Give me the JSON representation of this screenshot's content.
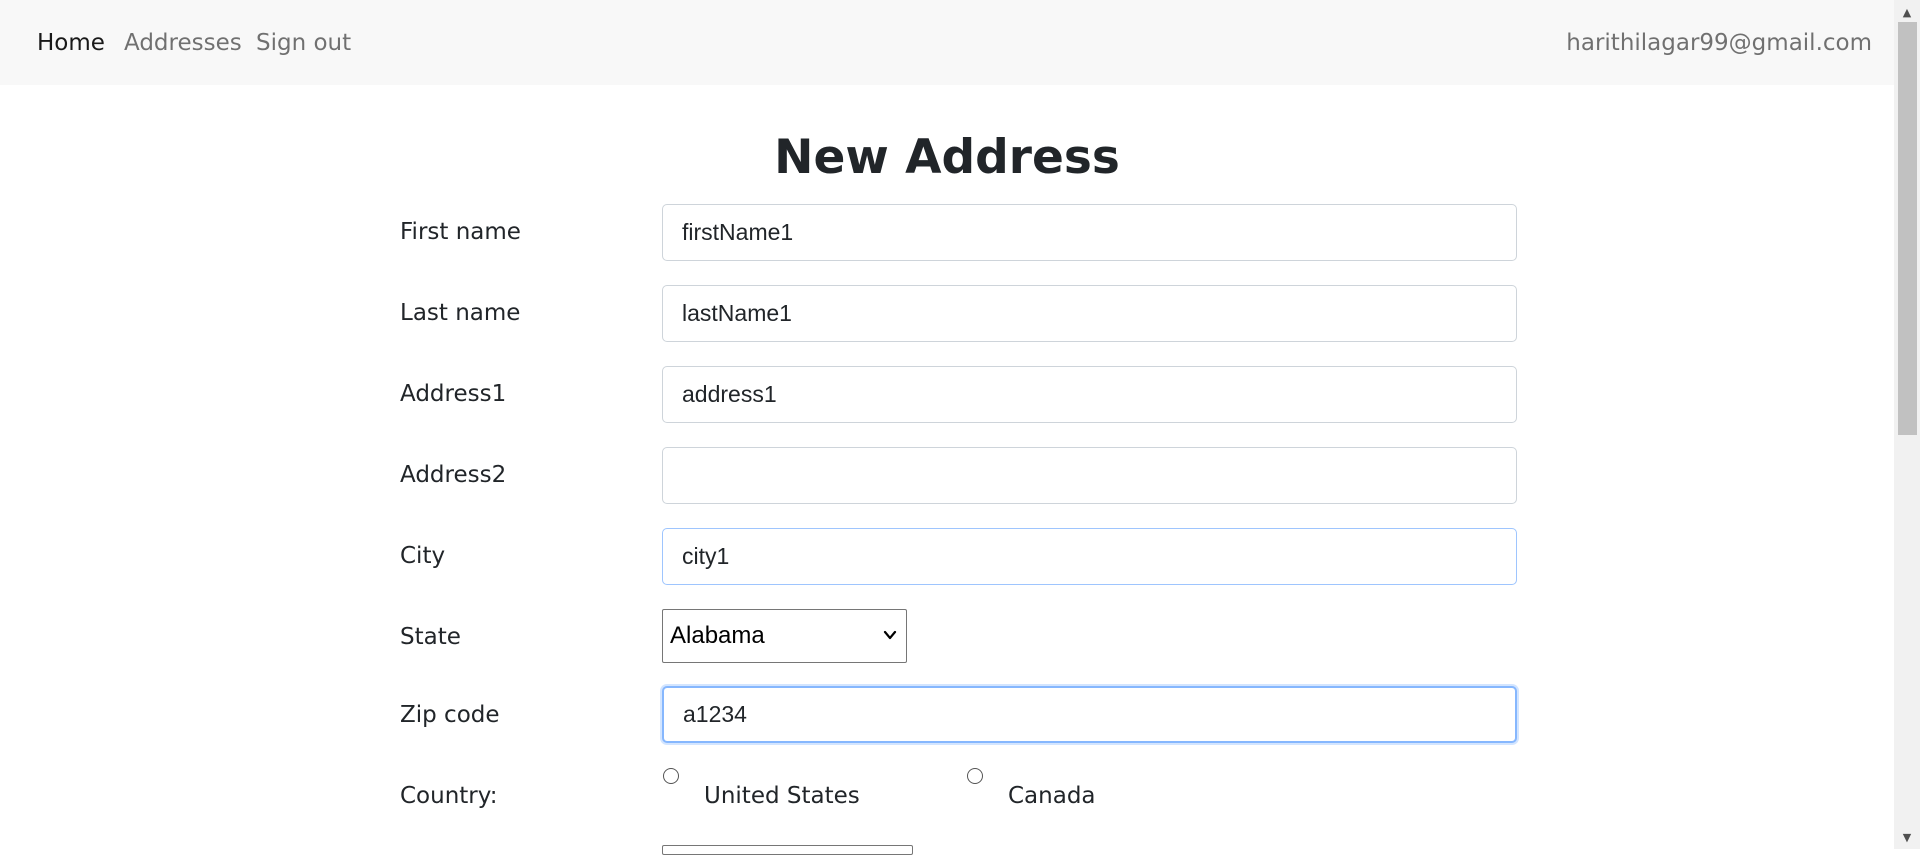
{
  "navbar": {
    "home": "Home",
    "addresses": "Addresses",
    "sign_out": "Sign out",
    "user_email": "harithilagar99@gmail.com"
  },
  "page": {
    "title": "New Address"
  },
  "form": {
    "first_name": {
      "label": "First name",
      "value": "firstName1"
    },
    "last_name": {
      "label": "Last name",
      "value": "lastName1"
    },
    "address1": {
      "label": "Address1",
      "value": "address1"
    },
    "address2": {
      "label": "Address2",
      "value": ""
    },
    "city": {
      "label": "City",
      "value": "city1"
    },
    "state": {
      "label": "State",
      "selected": "Alabama"
    },
    "zip_code": {
      "label": "Zip code",
      "value": "a1234"
    },
    "country": {
      "label": "Country:",
      "options": [
        "United States",
        "Canada"
      ]
    }
  },
  "icons": {
    "select_arrow": "chevron-down-icon",
    "scroll_up": "scroll-up-arrow-icon",
    "scroll_down": "scroll-down-arrow-icon"
  },
  "colors": {
    "navbar_bg": "#f8f8f8",
    "focus_border": "#86b7fe",
    "text": "#212529"
  }
}
